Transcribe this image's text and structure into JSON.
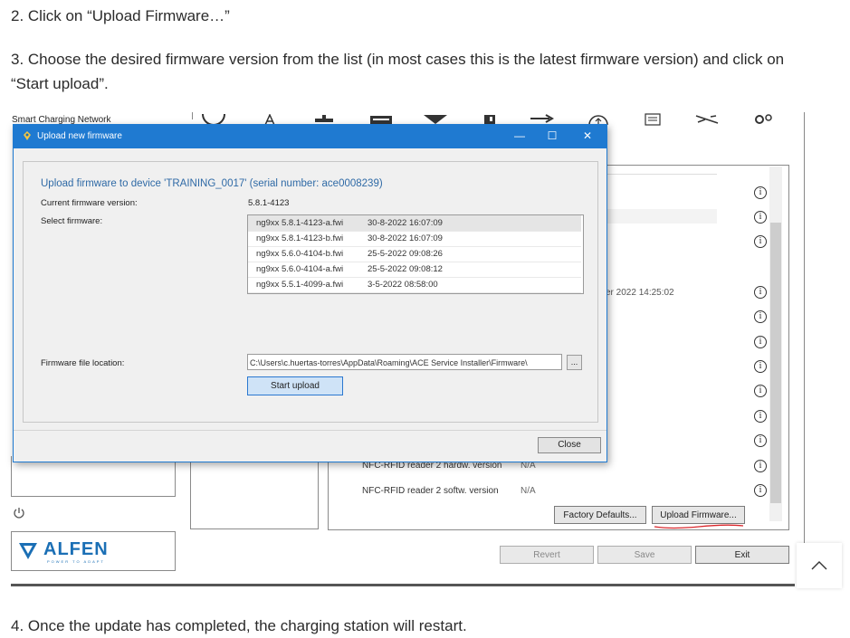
{
  "steps": {
    "step2": "2. Click on “Upload Firmware…”",
    "step3": "3. Choose the desired firmware version from the list (in most cases this is the latest firmware version) and click on “Start upload”.",
    "step4": "4. Once the update has completed, the charging station will restart."
  },
  "app": {
    "title": "Smart Charging Network",
    "partial_date": "er 2022 14:25:02",
    "rows": [
      {
        "label": "NFC-RFID reader 2 hardw. version",
        "value": "N/A"
      },
      {
        "label": "NFC-RFID reader 2 softw. version",
        "value": "N/A"
      }
    ],
    "factory_defaults": "Factory Defaults...",
    "upload_firmware": "Upload Firmware...",
    "revert": "Revert",
    "save": "Save",
    "exit": "Exit",
    "logo_text": "ALFEN",
    "logo_tagline": "POWER TO ADAPT",
    "info_glyph": "i"
  },
  "dialog": {
    "title": "Upload new firmware",
    "heading": "Upload firmware to device 'TRAINING_0017' (serial number: ace0008239)",
    "current_label": "Current firmware version:",
    "current_value": "5.8.1-4123",
    "select_label": "Select firmware:",
    "firmware_list": [
      {
        "name": "ng9xx 5.8.1-4123-a.fwi",
        "date": "30-8-2022 16:07:09",
        "selected": true
      },
      {
        "name": "ng9xx 5.8.1-4123-b.fwi",
        "date": "30-8-2022 16:07:09",
        "selected": false
      },
      {
        "name": "ng9xx 5.6.0-4104-b.fwi",
        "date": "25-5-2022 09:08:26",
        "selected": false
      },
      {
        "name": "ng9xx 5.6.0-4104-a.fwi",
        "date": "25-5-2022 09:08:12",
        "selected": false
      },
      {
        "name": "ng9xx 5.5.1-4099-a.fwi",
        "date": "3-5-2022 08:58:00",
        "selected": false
      }
    ],
    "location_label": "Firmware file location:",
    "location_value": "C:\\Users\\c.huertas-torres\\AppData\\Roaming\\ACE Service Installer\\Firmware\\",
    "browse": "...",
    "start_upload": "Start upload",
    "close": "Close",
    "minimize": "—",
    "maximize": "☐",
    "close_x": "✕"
  },
  "icons": [
    "power-icon",
    "info-icon",
    "chevron-up-icon",
    "alfen-logo-mark"
  ],
  "colors": {
    "accent": "#1f7ad1",
    "heading": "#2f6aa6",
    "logo": "#1b6fb5",
    "underline": "#d9262b"
  }
}
